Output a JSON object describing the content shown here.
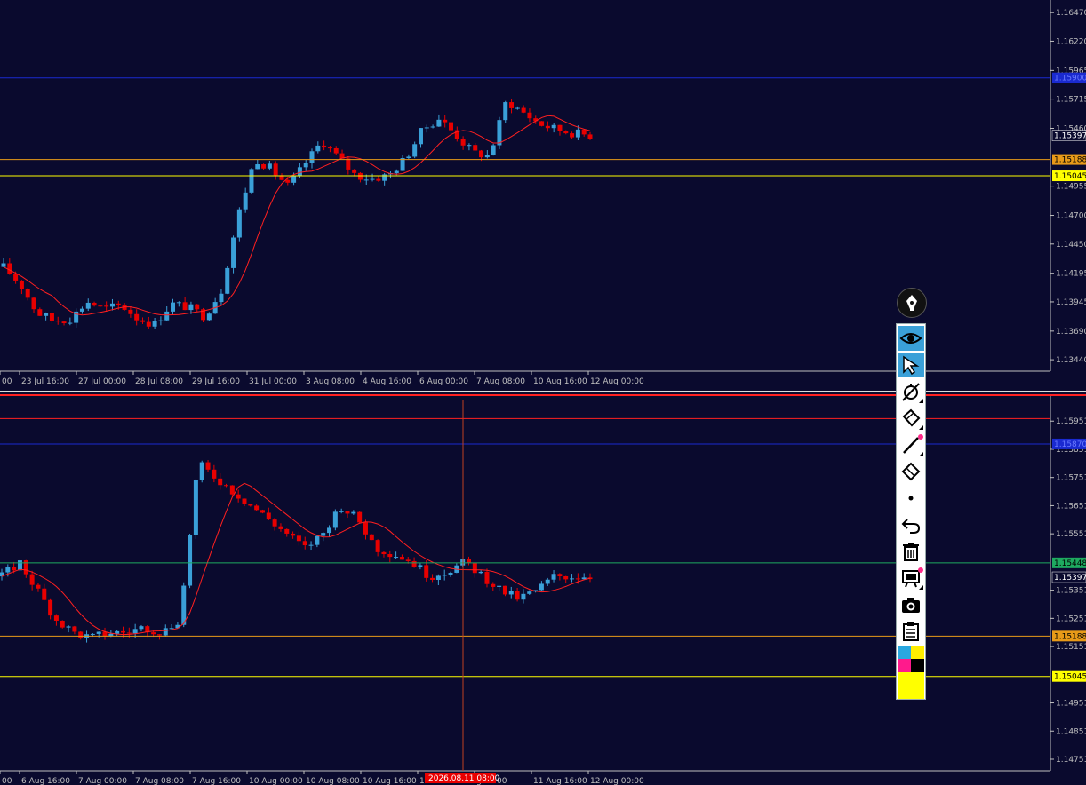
{
  "colors": {
    "background": "#0a0a2e",
    "bull_candle": "#3aa0d8",
    "bear_candle": "#e80000",
    "moving_average": "#ff2020",
    "axis": "#c0c0c0",
    "level_blue": "#1a2ad0",
    "level_orange": "#e89a18",
    "level_yellow": "#ffff00",
    "level_green": "#1eaa60",
    "label_text": "#000000"
  },
  "top_chart": {
    "ylim": [
      1.1334,
      1.1658
    ],
    "price_ticks": [
      "1.16470",
      "1.16220",
      "1.15965",
      "1.15715",
      "1.15460",
      "1.14955",
      "1.14700",
      "1.14450",
      "1.14195",
      "1.13945",
      "1.13690",
      "1.13440"
    ],
    "time_ticks": [
      "00",
      "23 Jul 16:00",
      "27 Jul 00:00",
      "28 Jul 08:00",
      "29 Jul 16:00",
      "31 Jul 00:00",
      "3 Aug 08:00",
      "4 Aug 16:00",
      "6 Aug 00:00",
      "7 Aug 08:00",
      "10 Aug 16:00",
      "12 Aug 00:00"
    ],
    "levels": [
      {
        "name": "blue",
        "price": 1.159,
        "label": "1.15900",
        "color": "#1a2ad0"
      },
      {
        "name": "orange",
        "price": 1.15188,
        "label": "1.15188",
        "color": "#e89a18"
      },
      {
        "name": "yellow",
        "price": 1.15045,
        "label": "1.15045",
        "color": "#ffff00"
      }
    ],
    "current_price_label": "1.15397",
    "current_price": 1.15397
  },
  "bottom_chart": {
    "ylim": [
      1.1471,
      1.1604
    ],
    "price_ticks": [
      "1.15951",
      "1.15851",
      "1.15751",
      "1.15651",
      "1.15551",
      "1.15351",
      "1.15251",
      "1.15151",
      "1.14951",
      "1.14851",
      "1.14751"
    ],
    "time_ticks": [
      "00",
      "6 Aug 16:00",
      "7 Aug 00:00",
      "7 Aug 08:00",
      "7 Aug 16:00",
      "10 Aug 00:00",
      "10 Aug 08:00",
      "10 Aug 16:00",
      "11",
      "g 08:00",
      "11 Aug 16:00",
      "12 Aug 00:00"
    ],
    "crosshair_time_label": "2026.08.11 08:00",
    "levels": [
      {
        "name": "red",
        "price": 1.1596,
        "label": "",
        "color": "#ff2020"
      },
      {
        "name": "blue",
        "price": 1.1587,
        "label": "1.15870",
        "color": "#1a2ad0"
      },
      {
        "name": "green",
        "price": 1.15448,
        "label": "1.15448",
        "color": "#1eaa60"
      },
      {
        "name": "orange",
        "price": 1.15188,
        "label": "1.15188",
        "color": "#e89a18"
      },
      {
        "name": "yellow",
        "price": 1.15045,
        "label": "1.15045",
        "color": "#ffff00"
      }
    ],
    "current_price_label": "1.15397",
    "current_price": 1.15397
  },
  "toolbar": {
    "tools": [
      "pen-icon",
      "eye-icon",
      "cursor-arrow-icon",
      "crosshair-off-icon",
      "eraser-tag-icon",
      "line-tool-icon",
      "ruler-icon",
      "dot-icon",
      "undo-icon",
      "trash-icon",
      "screen-icon",
      "camera-icon",
      "clipboard-icon"
    ],
    "palette": [
      "#29a8e0",
      "#ffee00",
      "#ff1a8c",
      "#000000",
      "#ffff00"
    ]
  }
}
